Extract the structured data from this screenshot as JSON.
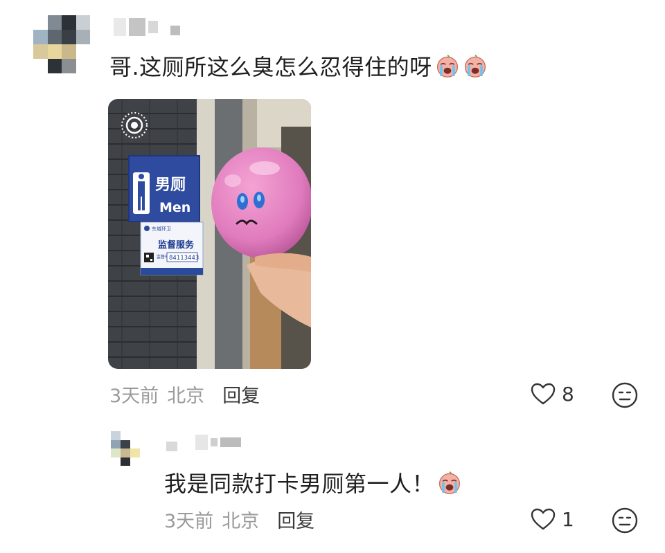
{
  "comment": {
    "text": "哥.这厕所这么臭怎么忍得住的呀",
    "emoji_count": 2,
    "emoji_icon": "crying-face-emoji-icon",
    "time": "3天前",
    "location": "北京",
    "reply_label": "回复",
    "likes": "8",
    "photo": {
      "sign_title": "男厕",
      "sign_subtitle": "Men",
      "info_brand": "东城环卫",
      "info_title": "监督服务",
      "phone_label": "监督电话",
      "phone_number": "84113443",
      "live_icon": "live-photo-icon",
      "plush_icon": "pink-plush-toy"
    }
  },
  "reply": {
    "text": "我是同款打卡男厕第一人！",
    "emoji_icon": "crying-face-emoji-icon",
    "time": "3天前",
    "location": "北京",
    "reply_label": "回复",
    "likes": "1"
  },
  "colors": {
    "meta_gray": "#9a9a9a",
    "text_dark": "#1f1f1f",
    "emoji_pink": "#f3a6a0"
  }
}
